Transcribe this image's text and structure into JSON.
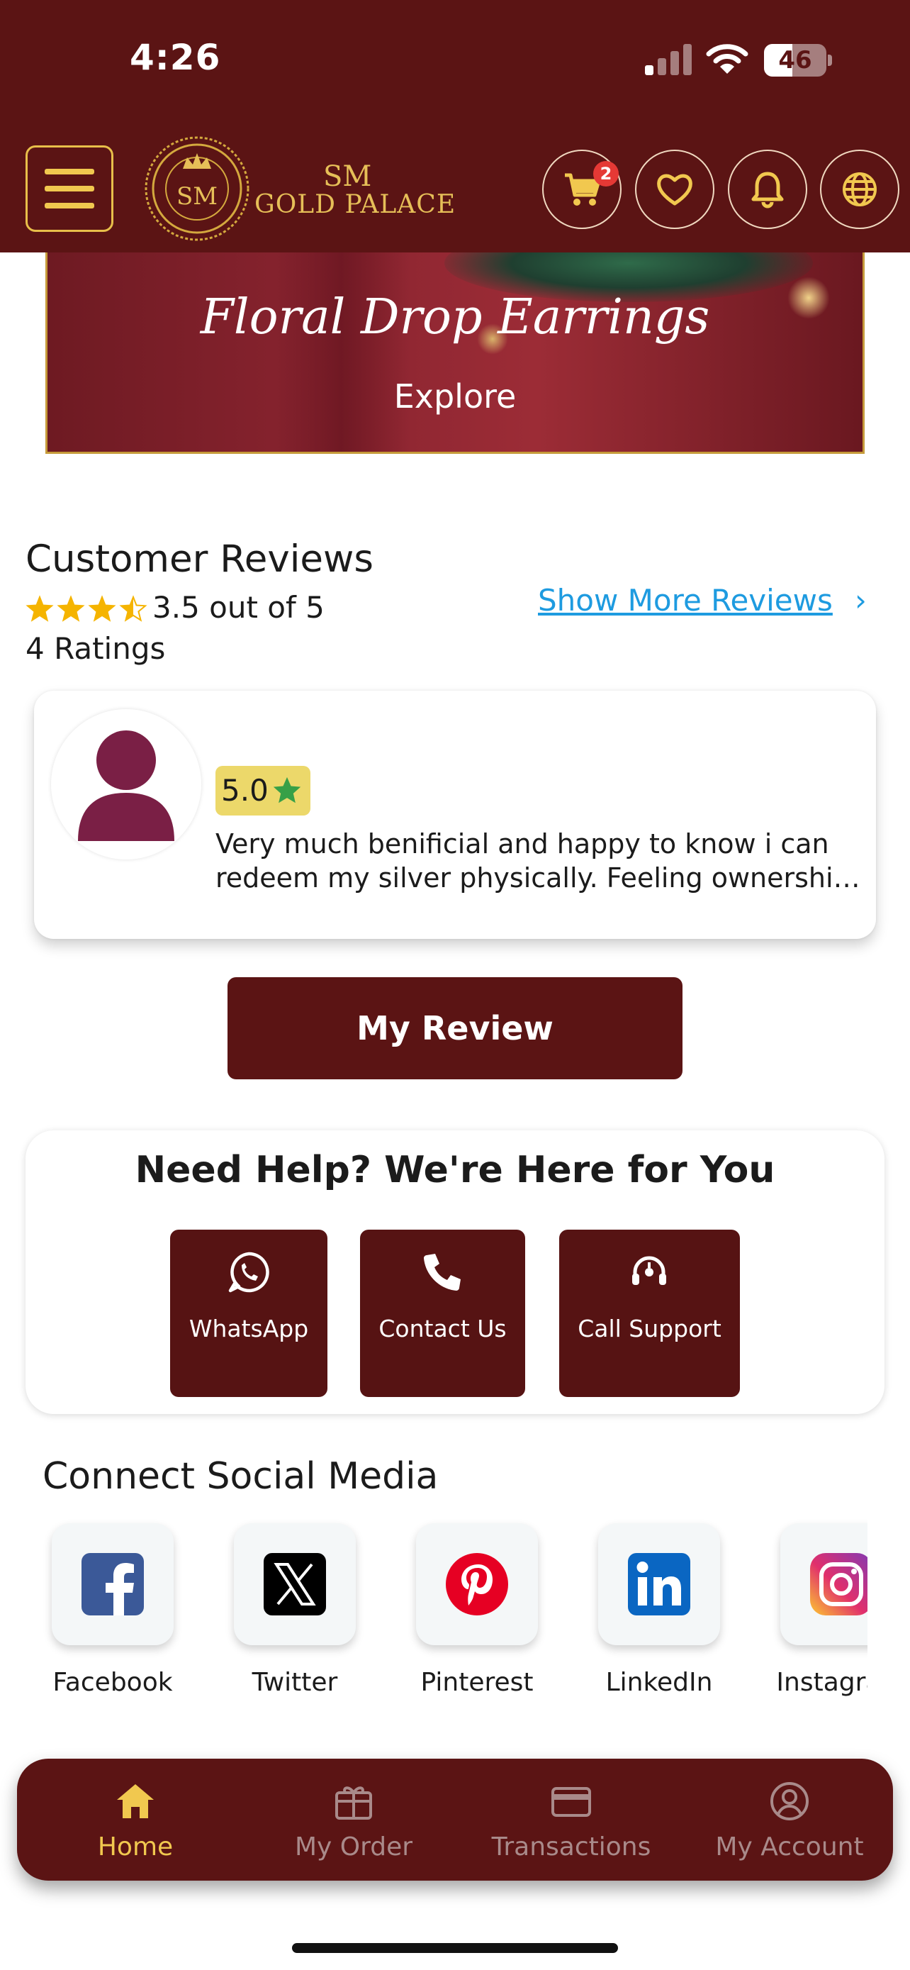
{
  "status_bar": {
    "time": "4:26",
    "battery": "46",
    "battery_level": 0.46
  },
  "header": {
    "brand_line1": "SM",
    "brand_line2": "GOLD PALACE",
    "logo_monogram": "SM",
    "cart_count": "2",
    "icons": [
      "menu-icon",
      "cart-icon",
      "heart-icon",
      "bell-icon",
      "globe-icon"
    ]
  },
  "banner": {
    "title": "Floral Drop Earrings",
    "subtitle": "Explore"
  },
  "reviews": {
    "title": "Customer Reviews",
    "stars_value": 3.5,
    "rating_text": "3.5 out of 5",
    "ratings_count": "4 Ratings",
    "show_more": "Show More Reviews",
    "chevron": "›",
    "items": [
      {
        "rating": "5.0",
        "text_line1": "Very much benificial and happy to know i can",
        "text_line2": "redeem my silver physically. Feeling ownership..."
      }
    ],
    "my_review_label": "My Review"
  },
  "help": {
    "title": "Need Help? We're Here for You",
    "buttons": [
      {
        "label": "WhatsApp",
        "icon": "whatsapp-icon"
      },
      {
        "label": "Contact Us",
        "icon": "phone-icon"
      },
      {
        "label": "Call Support",
        "icon": "headset-icon"
      }
    ]
  },
  "social": {
    "title": "Connect Social Media",
    "items": [
      {
        "label": "Facebook",
        "icon": "facebook-icon",
        "color": "#3b5998"
      },
      {
        "label": "Twitter",
        "icon": "x-icon",
        "color": "#000000"
      },
      {
        "label": "Pinterest",
        "icon": "pinterest-icon",
        "color": "#e60023"
      },
      {
        "label": "LinkedIn",
        "icon": "linkedin-icon",
        "color": "#0a66c2"
      },
      {
        "label": "Instagram",
        "icon": "instagram-icon",
        "color": "#e1306c"
      }
    ]
  },
  "bottom_nav": {
    "items": [
      {
        "label": "Home",
        "icon": "home-icon",
        "active": true
      },
      {
        "label": "My Order",
        "icon": "gift-box-icon",
        "active": false
      },
      {
        "label": "Transactions",
        "icon": "card-icon",
        "active": false
      },
      {
        "label": "My Account",
        "icon": "account-icon",
        "active": false
      }
    ]
  },
  "colors": {
    "primary": "#5b1414",
    "gold": "#f1c84f",
    "link": "#1e9be0",
    "star": "#f5b400"
  }
}
